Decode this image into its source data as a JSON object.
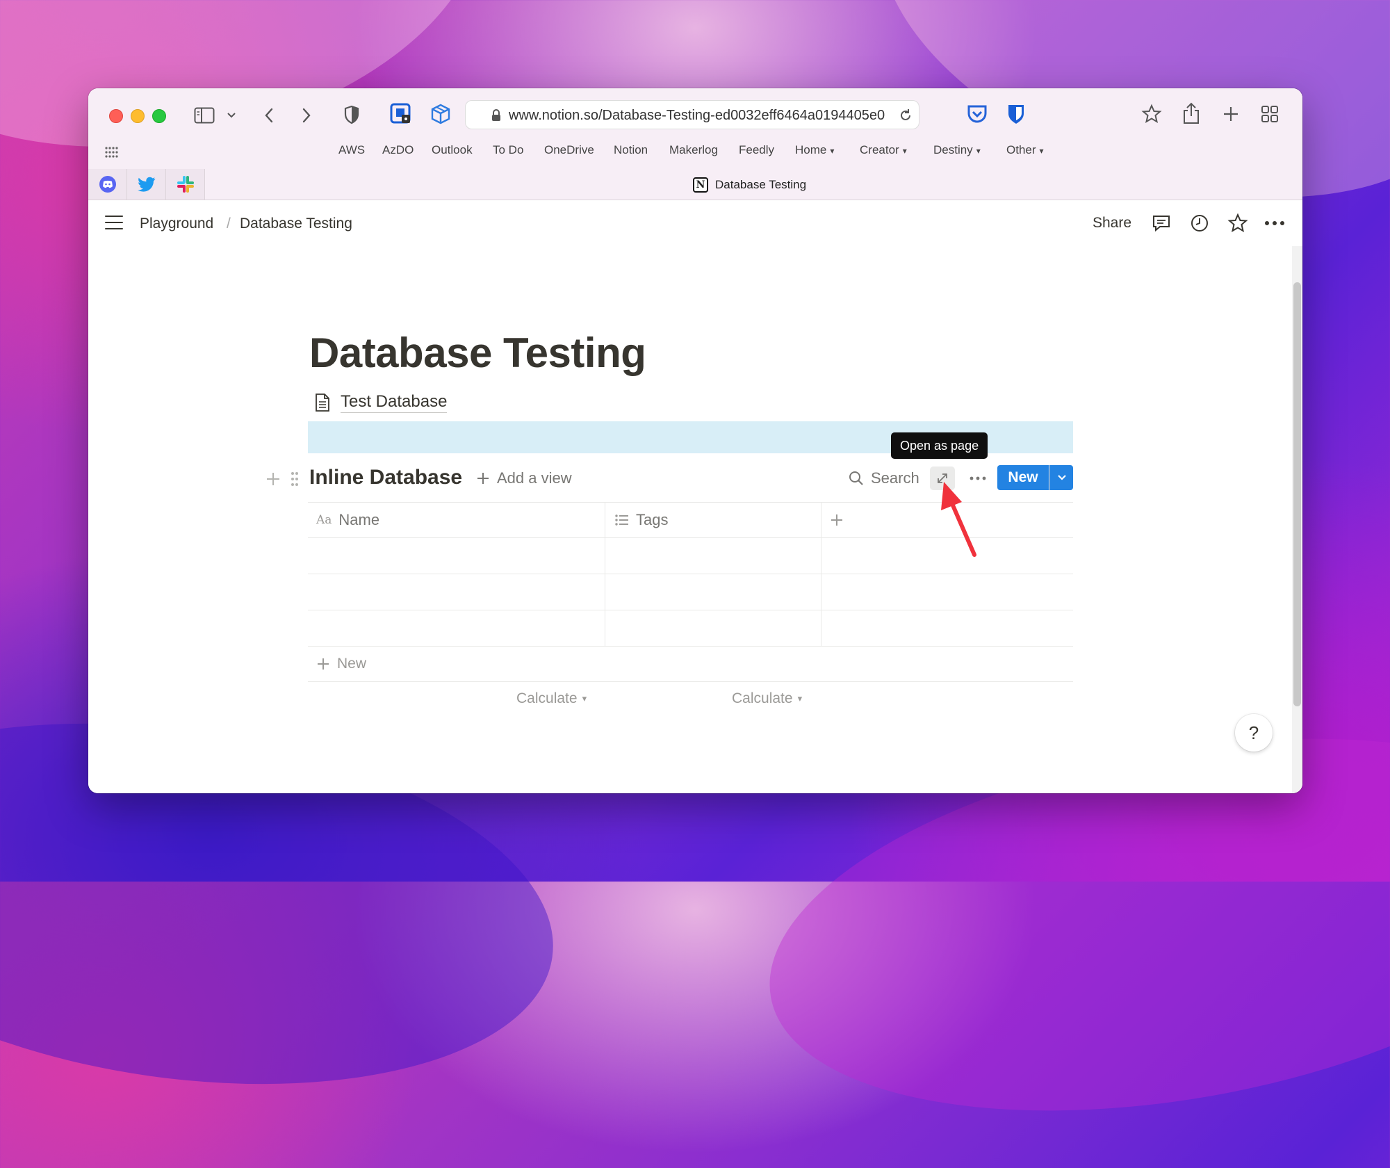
{
  "browser": {
    "url": "www.notion.so/Database-Testing-ed0032eff6464a0194405e0",
    "bookmarks": [
      {
        "label": "AWS",
        "dropdown": false
      },
      {
        "label": "AzDO",
        "dropdown": false
      },
      {
        "label": "Outlook",
        "dropdown": false
      },
      {
        "label": "To Do",
        "dropdown": false
      },
      {
        "label": "OneDrive",
        "dropdown": false
      },
      {
        "label": "Notion",
        "dropdown": false
      },
      {
        "label": "Makerlog",
        "dropdown": false
      },
      {
        "label": "Feedly",
        "dropdown": false
      },
      {
        "label": "Home",
        "dropdown": true
      },
      {
        "label": "Creator",
        "dropdown": true
      },
      {
        "label": "Destiny",
        "dropdown": true
      },
      {
        "label": "Other",
        "dropdown": true
      }
    ],
    "pinned_tabs": [
      "discord-icon",
      "twitter-icon",
      "slack-icon"
    ],
    "active_tab_title": "Database Testing"
  },
  "topbar": {
    "breadcrumb": [
      "Playground",
      "Database Testing"
    ],
    "separator": "/",
    "share_label": "Share"
  },
  "page": {
    "title": "Database Testing",
    "linked_page": "Test Database",
    "tooltip": "Open as page"
  },
  "database": {
    "title": "Inline Database",
    "add_view_label": "Add a view",
    "search_label": "Search",
    "new_label": "New",
    "columns": [
      {
        "label": "Name",
        "icon": "text-type-icon"
      },
      {
        "label": "Tags",
        "icon": "list-icon"
      }
    ],
    "row_count": 3,
    "new_row_label": "New",
    "calculate_label": "Calculate"
  },
  "help_label": "?",
  "colors": {
    "accent": "#2383e2",
    "highlight": "#d8eef7",
    "annotation_arrow": "#f0323c"
  }
}
